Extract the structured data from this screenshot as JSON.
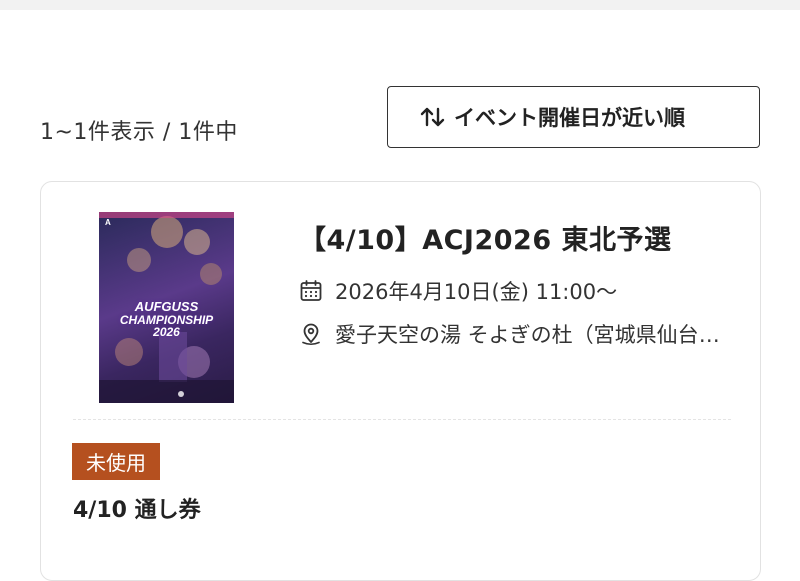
{
  "results": {
    "count_text": "1~1件表示 / 1件中"
  },
  "sort": {
    "label": "イベント開催日が近い順",
    "icon": "sort-arrows-icon"
  },
  "event": {
    "poster": {
      "brand_mark": "A",
      "title_lines": [
        "AUFGUSS",
        "CHAMPIONSHIP",
        "2026"
      ]
    },
    "title": "【4/10】ACJ2026 東北予選",
    "datetime": "2026年4月10日(金) 11:00〜",
    "datetime_icon": "calendar-icon",
    "venue": "愛子天空の湯 そよぎの杜（宮城県仙台市）",
    "venue_icon": "map-pin-icon"
  },
  "ticket": {
    "status": "未使用",
    "status_color": "#b5501f",
    "name": "4/10 通し券"
  }
}
